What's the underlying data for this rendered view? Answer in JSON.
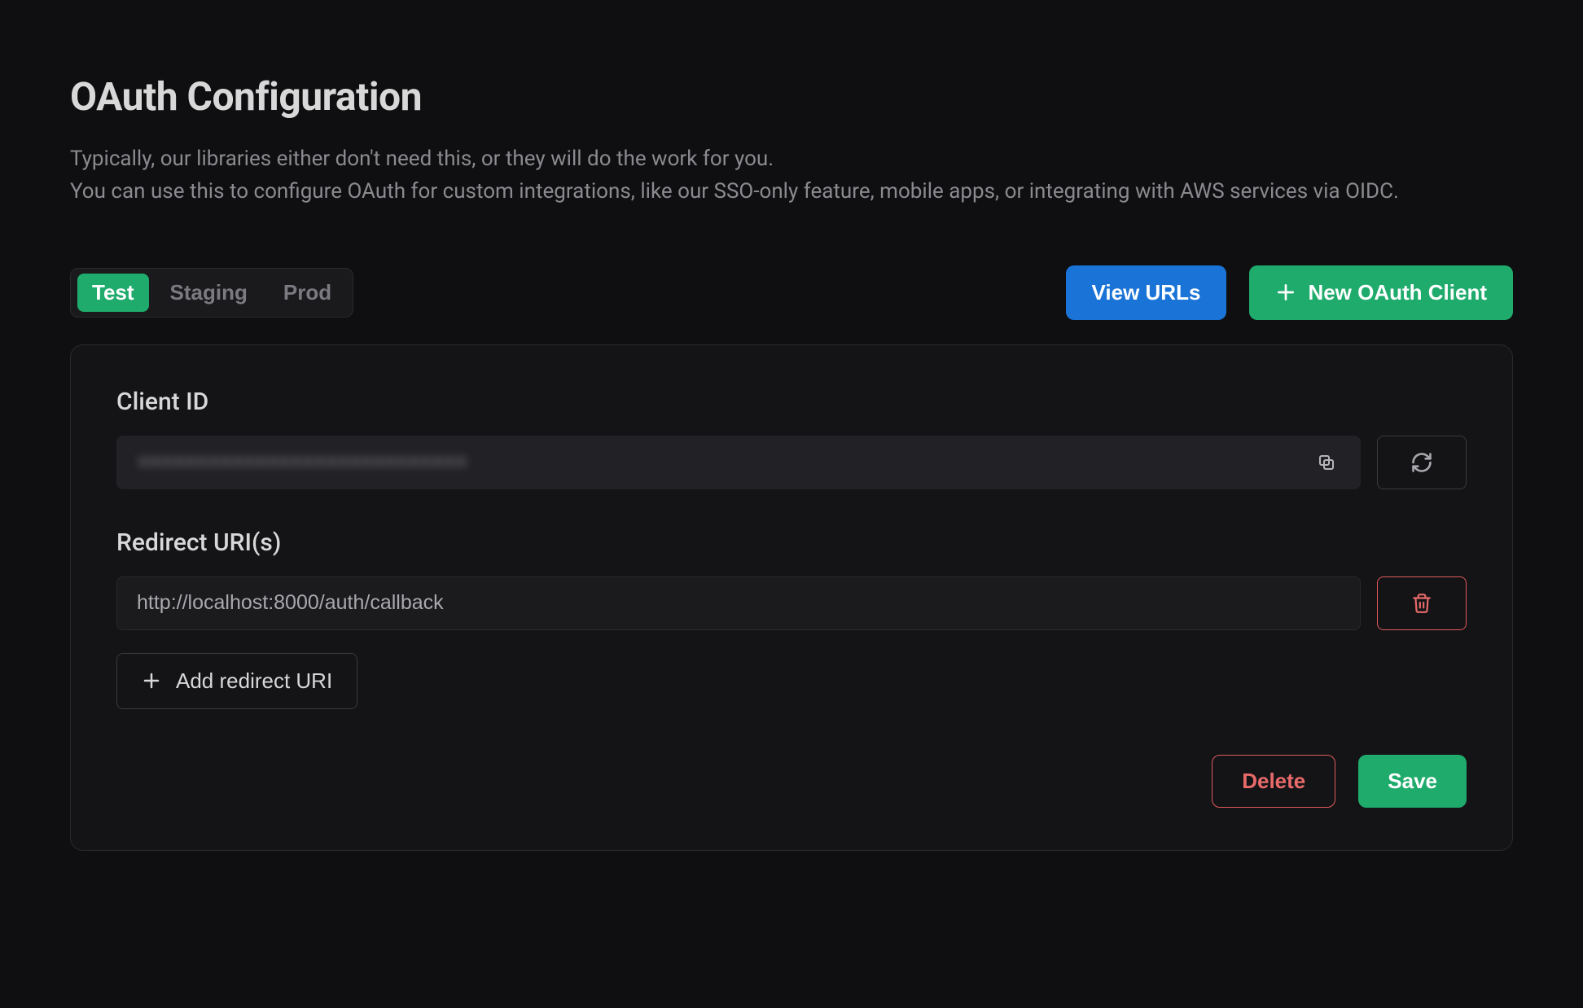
{
  "page": {
    "title": "OAuth Configuration",
    "description_line1": "Typically, our libraries either don't need this, or they will do the work for you.",
    "description_line2": "You can use this to configure OAuth for custom integrations, like our SSO-only feature, mobile apps, or integrating with AWS services via OIDC."
  },
  "tabs": [
    {
      "label": "Test",
      "active": true
    },
    {
      "label": "Staging",
      "active": false
    },
    {
      "label": "Prod",
      "active": false
    }
  ],
  "toolbar": {
    "view_urls_label": "View URLs",
    "new_client_label": "New OAuth Client"
  },
  "client": {
    "id_label": "Client ID",
    "id_value": "••••••••••••••••••••••••••••",
    "redirect_label": "Redirect URI(s)",
    "redirect_uris": [
      {
        "value": "http://localhost:8000/auth/callback"
      }
    ],
    "add_redirect_label": "Add redirect URI"
  },
  "actions": {
    "delete_label": "Delete",
    "save_label": "Save"
  },
  "colors": {
    "green": "#1fab6c",
    "blue": "#1a73d6",
    "danger": "#e86a6a",
    "bg": "#0f0f11",
    "card": "#141417"
  }
}
